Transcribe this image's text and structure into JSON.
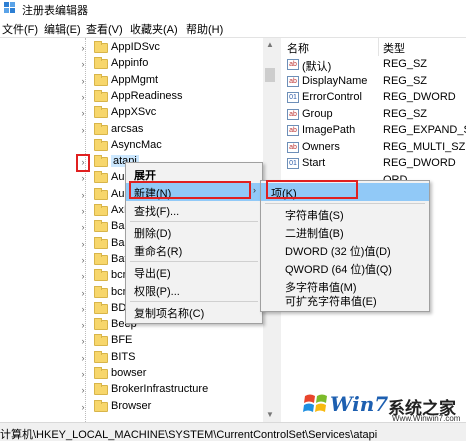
{
  "window": {
    "title": "注册表编辑器"
  },
  "menubar": {
    "items": [
      "文件(F)",
      "编辑(E)",
      "查看(V)",
      "收藏夹(A)",
      "帮助(H)"
    ]
  },
  "tree": {
    "items": [
      {
        "label": "AppIDSvc",
        "arrow": "›"
      },
      {
        "label": "Appinfo",
        "arrow": "›"
      },
      {
        "label": "AppMgmt",
        "arrow": "›"
      },
      {
        "label": "AppReadiness",
        "arrow": "›"
      },
      {
        "label": "AppXSvc",
        "arrow": "›"
      },
      {
        "label": "arcsas",
        "arrow": "›"
      },
      {
        "label": "AsyncMac",
        "arrow": ""
      },
      {
        "label": "atapi",
        "arrow": "›",
        "selected": true
      },
      {
        "label": "Audi",
        "arrow": "›"
      },
      {
        "label": "Audi",
        "arrow": "›"
      },
      {
        "label": "AxIn",
        "arrow": "›"
      },
      {
        "label": "Basic",
        "arrow": "›"
      },
      {
        "label": "Basic",
        "arrow": "›"
      },
      {
        "label": "BattC",
        "arrow": "›"
      },
      {
        "label": "bcm",
        "arrow": "›"
      },
      {
        "label": "bcm",
        "arrow": "›"
      },
      {
        "label": "BDES",
        "arrow": "›"
      },
      {
        "label": "Beep",
        "arrow": "›"
      },
      {
        "label": "BFE",
        "arrow": "›"
      },
      {
        "label": "BITS",
        "arrow": "›"
      },
      {
        "label": "bowser",
        "arrow": "›"
      },
      {
        "label": "BrokerInfrastructure",
        "arrow": "›"
      },
      {
        "label": "Browser",
        "arrow": "›"
      }
    ]
  },
  "values": {
    "col_name": "名称",
    "col_type": "类型",
    "rows": [
      {
        "name": "(默认)",
        "type": "REG_SZ",
        "icon": "ab"
      },
      {
        "name": "DisplayName",
        "type": "REG_SZ",
        "icon": "ab"
      },
      {
        "name": "ErrorControl",
        "type": "REG_DWORD",
        "icon": "01"
      },
      {
        "name": "Group",
        "type": "REG_SZ",
        "icon": "ab"
      },
      {
        "name": "ImagePath",
        "type": "REG_EXPAND_SZ",
        "icon": "ab"
      },
      {
        "name": "Owners",
        "type": "REG_MULTI_SZ",
        "icon": "ab"
      },
      {
        "name": "Start",
        "type": "REG_DWORD",
        "icon": "01"
      },
      {
        "name": "",
        "type": "ORD",
        "icon": ""
      },
      {
        "name": "",
        "type": "ORD",
        "icon": ""
      }
    ]
  },
  "context_menu": {
    "items": [
      "展开",
      "新建(N)",
      "查找(F)...",
      "删除(D)",
      "重命名(R)",
      "导出(E)",
      "权限(P)...",
      "复制项名称(C)"
    ],
    "submenu_arrow": "›"
  },
  "submenu": {
    "items": [
      "项(K)",
      "字符串值(S)",
      "二进制值(B)",
      "DWORD (32 位)值(D)",
      "QWORD (64 位)值(Q)",
      "多字符串值(M)",
      "可扩充字符串值(E)"
    ]
  },
  "statusbar": {
    "path": "计算机\\HKEY_LOCAL_MACHINE\\SYSTEM\\CurrentControlSet\\Services\\atapi"
  },
  "watermark": {
    "brand": "Win7",
    "cn": "系统之家",
    "url": "Www.Winwin7.com"
  },
  "colors": {
    "highlight": "#91c9f7",
    "red_box": "#e02020",
    "selection": "#cce8ff"
  }
}
